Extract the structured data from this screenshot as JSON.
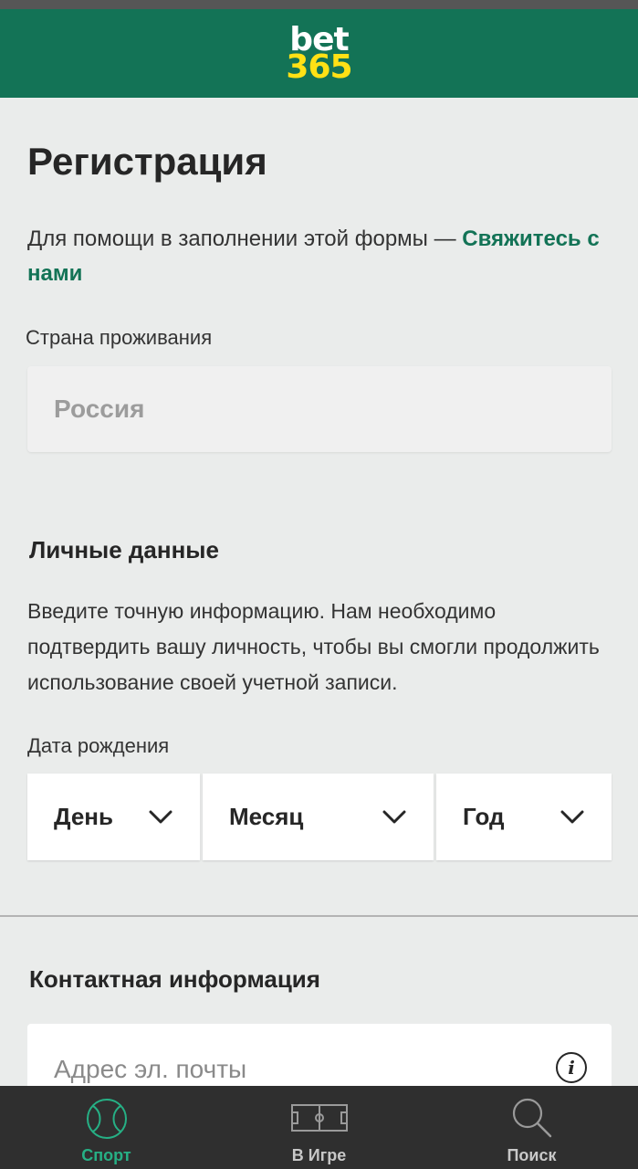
{
  "header": {
    "logo_line1": "bet",
    "logo_line2": "365",
    "brand_color": "#137356",
    "logo_accent": "#ffe115"
  },
  "page": {
    "title": "Регистрация",
    "help_text": "Для помощи в заполнении этой формы — ",
    "help_link": "Свяжитесь с нами"
  },
  "country": {
    "label": "Страна проживания",
    "value": "Россия"
  },
  "personal": {
    "title": "Личные данные",
    "description": "Введите точную информацию. Нам необходимо подтвердить вашу личность, чтобы вы смогли продолжить использование своей учетной записи.",
    "dob_label": "Дата рождения",
    "day": "День",
    "month": "Месяц",
    "year": "Год"
  },
  "contact": {
    "title": "Контактная информация",
    "email_placeholder": "Адрес эл. почты"
  },
  "nav": {
    "sport": "Спорт",
    "in_play": "В Игре",
    "search": "Поиск",
    "active_color": "#26b085",
    "icons": [
      "tennis-ball-icon",
      "pitch-icon",
      "search-icon"
    ]
  }
}
